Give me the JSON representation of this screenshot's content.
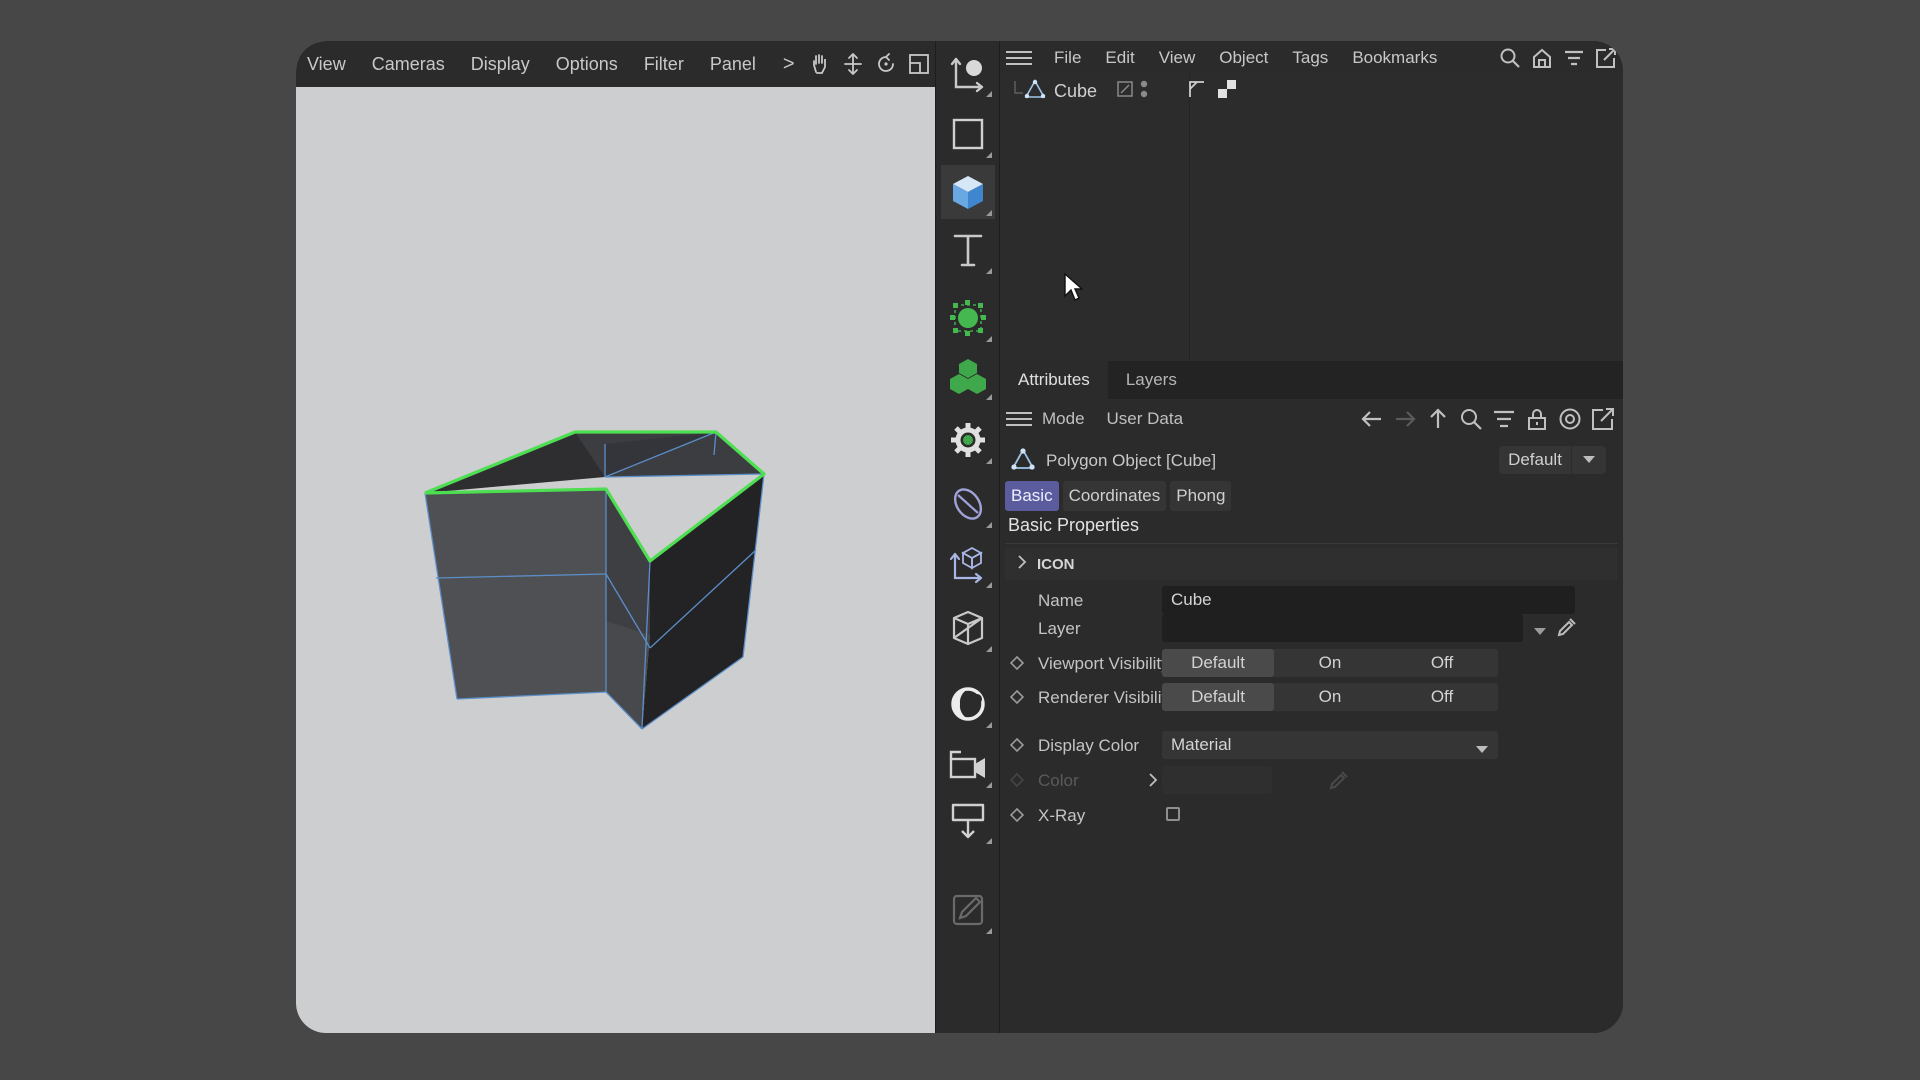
{
  "viewport": {
    "menu": [
      "View",
      "Cameras",
      "Display",
      "Options",
      "Filter",
      "Panel"
    ],
    "more_label": ">"
  },
  "toolbar": {
    "tools": [
      "move-tool-icon",
      "rectangle-select-icon",
      "cube-icon",
      "text-icon",
      "subdivision-icon",
      "cloner-icon",
      "deformer-gear-icon",
      "field-icon",
      "spline-object-icon",
      "scene-icon",
      "light-icon",
      "camera-icon",
      "tag-icon",
      "pencil-icon"
    ]
  },
  "object_manager": {
    "menu": [
      "File",
      "Edit",
      "View",
      "Object",
      "Tags",
      "Bookmarks"
    ],
    "objects": [
      {
        "name": "Cube"
      }
    ]
  },
  "attributes": {
    "tabs": [
      "Attributes",
      "Layers"
    ],
    "toolbar_links": [
      "Mode",
      "User Data"
    ],
    "object_title": "Polygon Object [Cube]",
    "preset": "Default",
    "subtabs": [
      "Basic",
      "Coordinates",
      "Phong"
    ],
    "section_title": "Basic Properties",
    "group_label": "ICON",
    "props": {
      "name_label": "Name",
      "name_value": "Cube",
      "layer_label": "Layer",
      "viewport_vis_label": "Viewport Visibility",
      "renderer_vis_label": "Renderer Visibility",
      "vis_options": [
        "Default",
        "On",
        "Off"
      ],
      "display_color_label": "Display Color",
      "display_color_value": "Material",
      "color_label": "Color",
      "xray_label": "X-Ray"
    }
  },
  "colors": {
    "selection_edge": "#4ede52",
    "active_subtab": "#5a5c9e",
    "background": "#474747"
  }
}
